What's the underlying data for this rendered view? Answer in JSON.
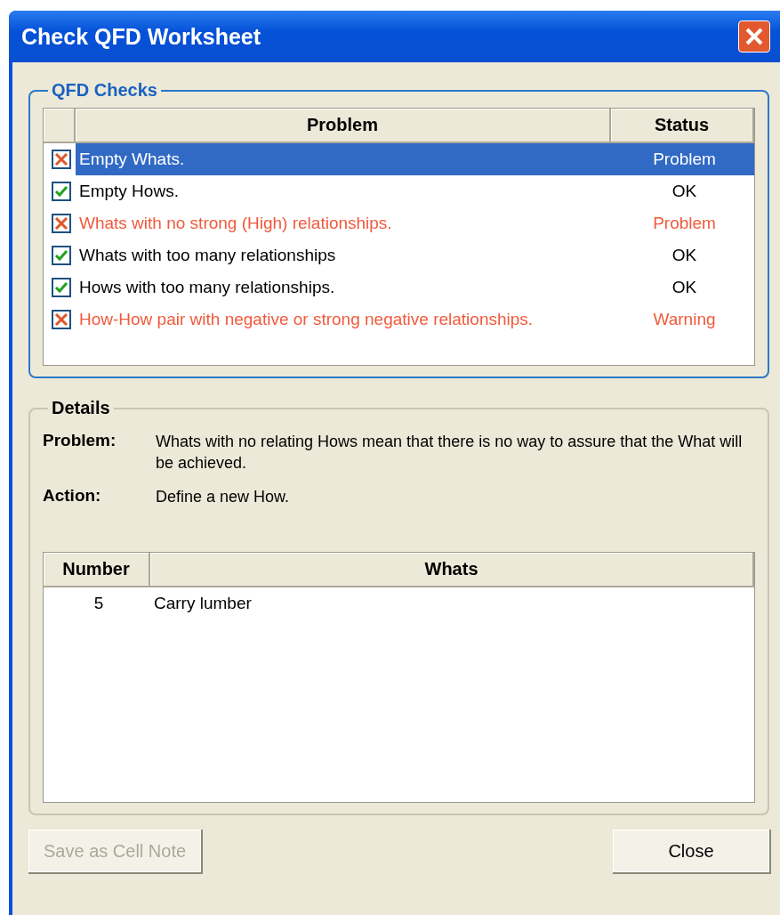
{
  "window": {
    "title": "Check QFD Worksheet"
  },
  "checks": {
    "title": "QFD Checks",
    "columns": [
      "Problem",
      "Status"
    ],
    "rows": [
      {
        "problem": "Empty Whats.",
        "status": "Problem",
        "passed": false,
        "selected": true
      },
      {
        "problem": "Empty Hows.",
        "status": "OK",
        "passed": true,
        "selected": false
      },
      {
        "problem": "Whats with no strong (High) relationships.",
        "status": "Problem",
        "passed": false,
        "selected": false
      },
      {
        "problem": "Whats with too many relationships",
        "status": "OK",
        "passed": true,
        "selected": false
      },
      {
        "problem": "Hows with too many relationships.",
        "status": "OK",
        "passed": true,
        "selected": false
      },
      {
        "problem": "How-How pair with negative or strong negative relationships.",
        "status": "Warning",
        "passed": false,
        "selected": false
      }
    ]
  },
  "details": {
    "title": "Details",
    "fields": [
      {
        "label": "Problem:",
        "value": "Whats with no relating Hows mean that there is no way to assure that the What will be achieved."
      },
      {
        "label": "Action:",
        "value": "Define a new How."
      }
    ],
    "table": {
      "columns": [
        "Number",
        "Whats"
      ],
      "rows": [
        {
          "number": "5",
          "whats": "Carry lumber"
        }
      ]
    }
  },
  "buttons": [
    {
      "label": "Save as Cell Note",
      "disabled": true
    },
    {
      "label": "Close",
      "disabled": false
    }
  ]
}
